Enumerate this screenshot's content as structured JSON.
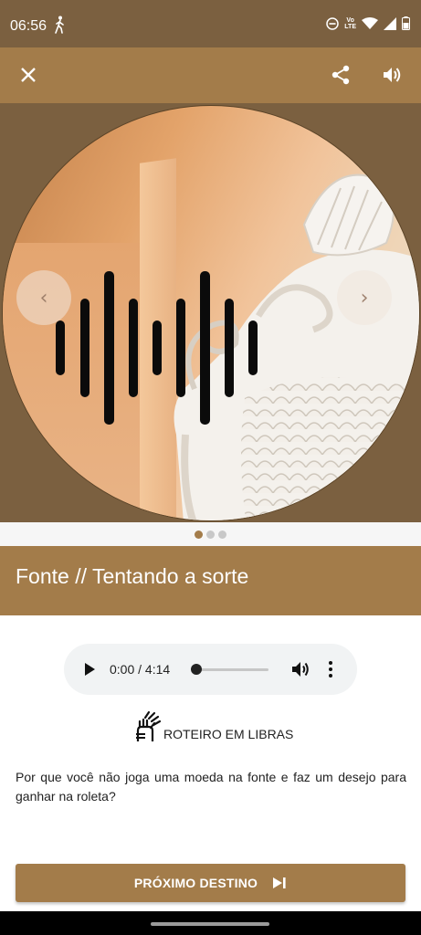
{
  "status_bar": {
    "time": "06:56",
    "network_label_top": "Vo",
    "network_label_bottom": "LTE"
  },
  "toolbar": {
    "close_icon": "close-icon",
    "share_icon": "share-icon",
    "volume_icon": "volume-icon"
  },
  "carousel": {
    "prev_icon": "chevron-left-icon",
    "next_icon": "chevron-right-icon",
    "prev_glyph": "‹",
    "next_glyph": "›",
    "slide_count": 3,
    "active_slide": 1
  },
  "title": "Fonte // Tentando a sorte",
  "player": {
    "time": "0:00 / 4:14",
    "progress": 0
  },
  "libras": {
    "label": "ROTEIRO EM LIBRAS",
    "icon": "sign-language-icon"
  },
  "description": "Por que você não joga uma moeda na fonte e faz um desejo para ganhar na roleta?",
  "next_button": {
    "label": "PRÓXIMO DESTINO",
    "icon": "skip-next-icon"
  },
  "colors": {
    "brand": "#a37c4a",
    "dark_brand": "#7b6040"
  }
}
